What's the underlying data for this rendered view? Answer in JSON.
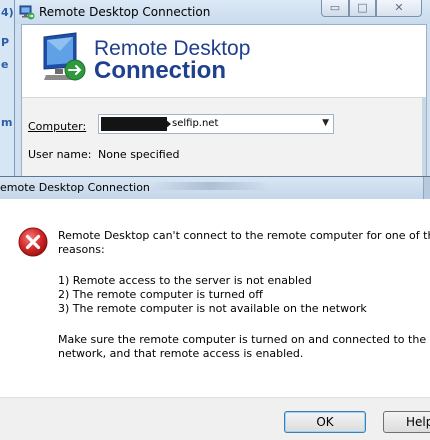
{
  "background": {
    "left_edge_chars": [
      "4)",
      "P",
      "e",
      "m"
    ]
  },
  "connection_window": {
    "title": "Remote Desktop Connection",
    "title_buttons": [
      "minimize-icon",
      "maximize-icon",
      "close-icon"
    ],
    "banner": {
      "line1": "Remote Desktop",
      "line2": "Connection"
    },
    "computer_label": "Computer:",
    "computer_value_visible": "selfip.net",
    "username_label": "User name:",
    "username_value": "None specified"
  },
  "error_dialog": {
    "title": "emote Desktop Connection",
    "icon": "error-icon",
    "message_line1": "Remote Desktop can't connect to the remote computer for one of thes",
    "message_line2": "reasons:",
    "reasons": [
      "1) Remote access to the server is not enabled",
      "2) The remote computer is turned off",
      "3) The remote computer is not available on the network"
    ],
    "advice_line1": "Make sure the remote computer is turned on and connected to the",
    "advice_line2": "network, and that remote access is enabled.",
    "buttons": {
      "ok": "OK",
      "help": "Help"
    }
  },
  "colors": {
    "banner_text": "#1f3f8f",
    "error_red": "#d42a2a",
    "titlebar": "#c8dbee"
  }
}
